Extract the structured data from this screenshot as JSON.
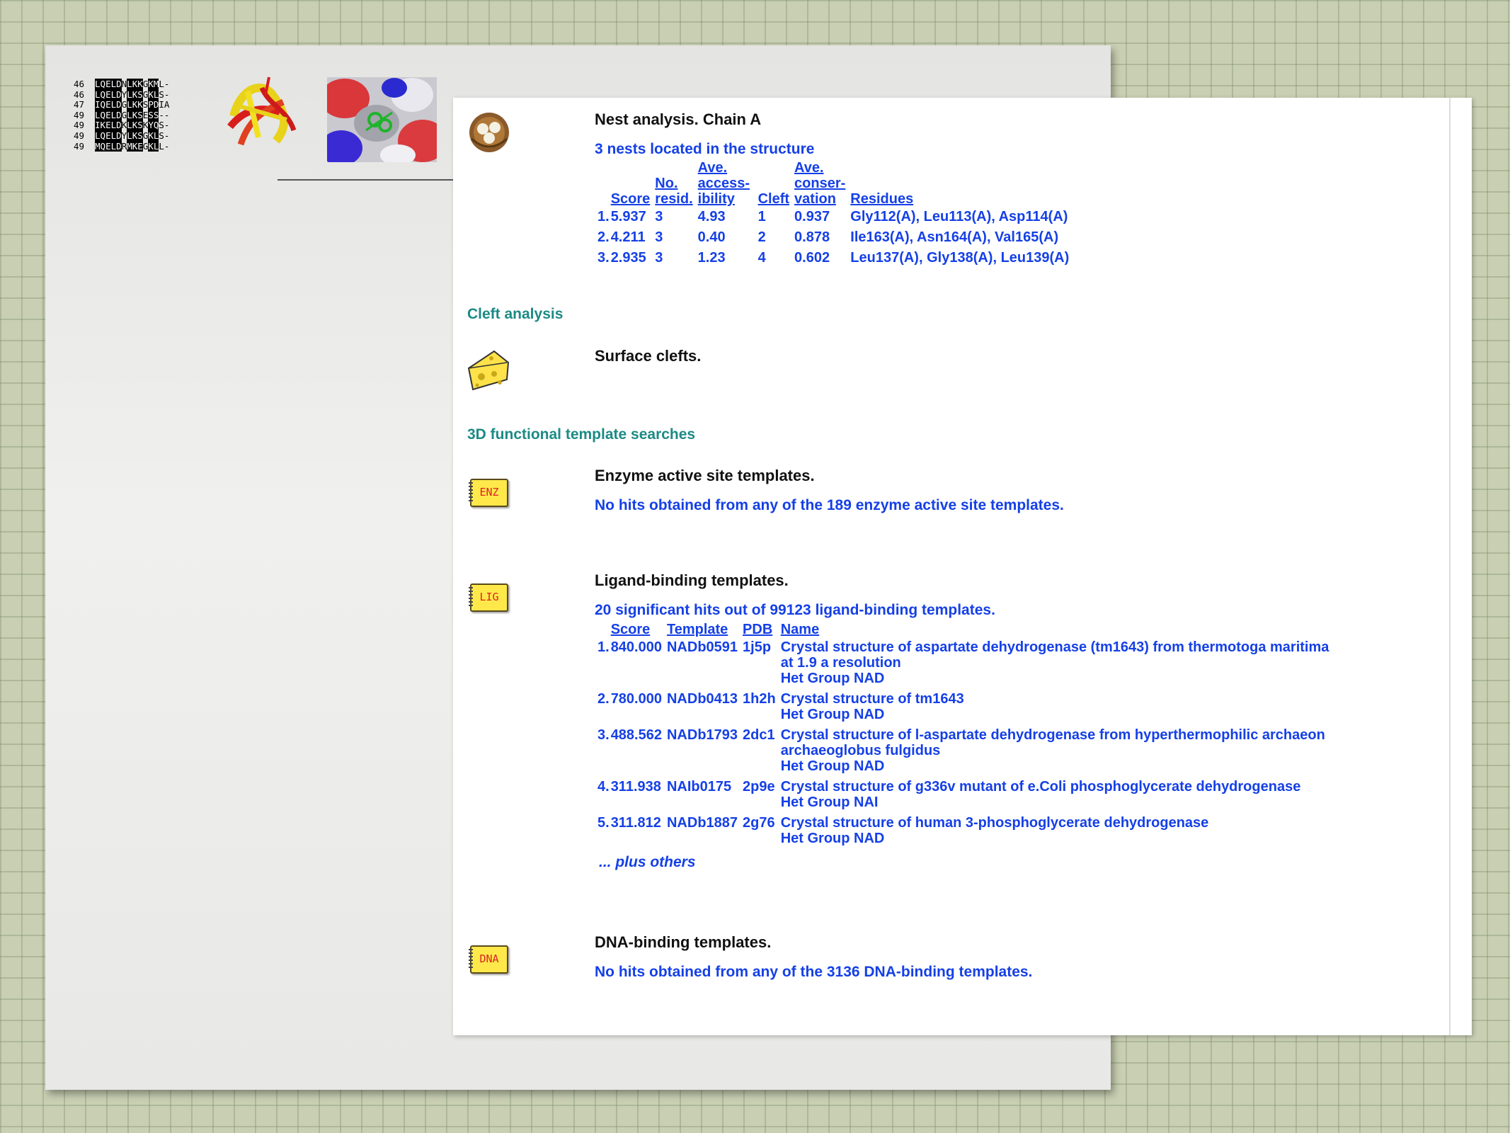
{
  "alignment_thumbnail": {
    "rows": [
      {
        "num": "46",
        "seq": "LQELDNLKKGKML-"
      },
      {
        "num": "46",
        "seq": "LQELDYLKSGKLS-"
      },
      {
        "num": "47",
        "seq": "IQELDGLKKSPDIA"
      },
      {
        "num": "49",
        "seq": "LQELDGLKSESS--"
      },
      {
        "num": "49",
        "seq": "IKELDKLKSKYQS-"
      },
      {
        "num": "49",
        "seq": "LQELDYLKSGKLS-"
      },
      {
        "num": "49",
        "seq": "MQELDRMKEGKLL-"
      }
    ]
  },
  "nest": {
    "icon": "nest-icon",
    "heading": "Nest analysis. Chain A",
    "summary": "3 nests located in the structure",
    "columns": {
      "score": "Score",
      "nres_1": "No.",
      "nres_2": "resid.",
      "acc_1": "Ave.",
      "acc_2": "access-",
      "acc_3": "ibility",
      "cleft": "Cleft",
      "cons_1": "Ave.",
      "cons_2": "conser-",
      "cons_3": "vation",
      "residues": "Residues"
    },
    "rows": [
      {
        "rank": "1.",
        "score": "5.937",
        "nres": "3",
        "acc": "4.93",
        "cleft": "1",
        "cons": "0.937",
        "residues": "Gly112(A), Leu113(A), Asp114(A)"
      },
      {
        "rank": "2.",
        "score": "4.211",
        "nres": "3",
        "acc": "0.40",
        "cleft": "2",
        "cons": "0.878",
        "residues": "Ile163(A), Asn164(A), Val165(A)"
      },
      {
        "rank": "3.",
        "score": "2.935",
        "nres": "3",
        "acc": "1.23",
        "cleft": "4",
        "cons": "0.602",
        "residues": "Leu137(A), Gly138(A), Leu139(A)"
      }
    ]
  },
  "cleft": {
    "section_title": "Cleft analysis",
    "icon": "cheese-icon",
    "heading": "Surface clefts."
  },
  "templates": {
    "section_title": "3D functional template searches",
    "enzyme": {
      "icon_label": "ENZ",
      "heading": "Enzyme active site templates.",
      "summary": "No hits obtained from any of the 189 enzyme active site templates."
    },
    "ligand": {
      "icon_label": "LIG",
      "heading": "Ligand-binding templates.",
      "summary": "20 significant hits out of 99123 ligand-binding templates.",
      "columns": {
        "score": "Score",
        "template": "Template",
        "pdb": "PDB",
        "name": "Name"
      },
      "rows": [
        {
          "rank": "1.",
          "score": "840.000",
          "template": "NADb0591",
          "pdb": "1j5p",
          "name_1": "Crystal structure of aspartate dehydrogenase (tm1643) from thermotoga maritima",
          "name_2": "at 1.9 a resolution",
          "het": "Het Group NAD"
        },
        {
          "rank": "2.",
          "score": "780.000",
          "template": "NADb0413",
          "pdb": "1h2h",
          "name_1": "Crystal structure of tm1643",
          "name_2": "",
          "het": "Het Group NAD"
        },
        {
          "rank": "3.",
          "score": "488.562",
          "template": "NADb1793",
          "pdb": "2dc1",
          "name_1": "Crystal structure of l-aspartate dehydrogenase from hyperthermophilic archaeon",
          "name_2": "archaeoglobus fulgidus",
          "het": "Het Group NAD"
        },
        {
          "rank": "4.",
          "score": "311.938",
          "template": "NAIb0175",
          "pdb": "2p9e",
          "name_1": "Crystal structure of g336v mutant of e.Coli phosphoglycerate dehydrogenase",
          "name_2": "",
          "het": "Het Group NAI"
        },
        {
          "rank": "5.",
          "score": "311.812",
          "template": "NADb1887",
          "pdb": "2g76",
          "name_1": "Crystal structure of human 3-phosphoglycerate dehydrogenase",
          "name_2": "",
          "het": "Het Group NAD"
        }
      ],
      "more": "... plus others"
    },
    "dna": {
      "icon_label": "DNA",
      "heading": "DNA-binding templates.",
      "summary": "No hits obtained from any of the 3136 DNA-binding templates."
    }
  }
}
